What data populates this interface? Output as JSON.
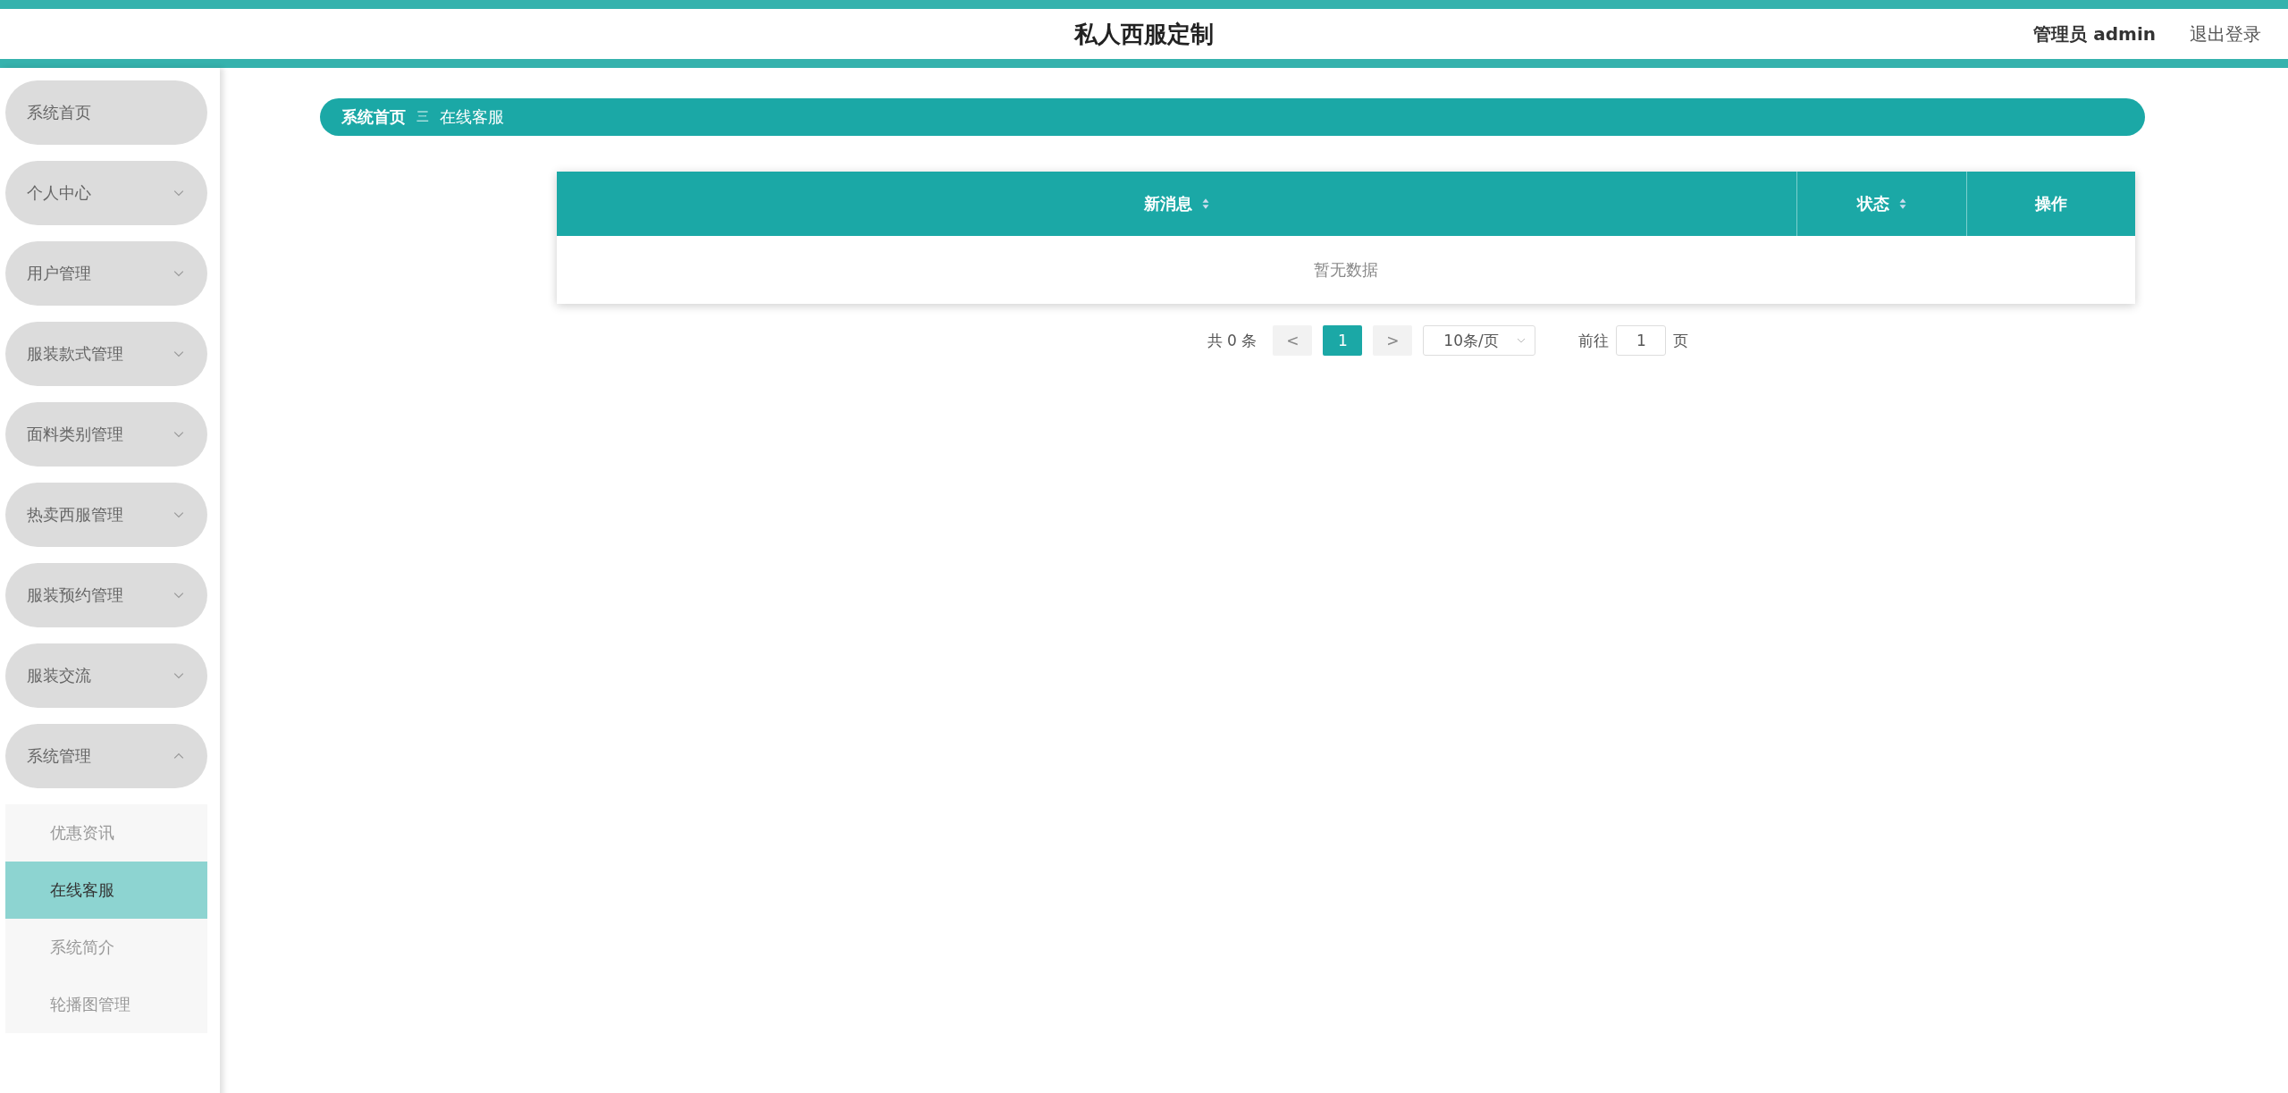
{
  "header": {
    "title": "私人西服定制",
    "user": "管理员 admin",
    "logout": "退出登录"
  },
  "sidebar": {
    "items": [
      {
        "label": "系统首页",
        "kind": "link"
      },
      {
        "label": "个人中心",
        "kind": "group",
        "expanded": false
      },
      {
        "label": "用户管理",
        "kind": "group",
        "expanded": false
      },
      {
        "label": "服装款式管理",
        "kind": "group",
        "expanded": false
      },
      {
        "label": "面料类别管理",
        "kind": "group",
        "expanded": false
      },
      {
        "label": "热卖西服管理",
        "kind": "group",
        "expanded": false
      },
      {
        "label": "服装预约管理",
        "kind": "group",
        "expanded": false
      },
      {
        "label": "服装交流",
        "kind": "group",
        "expanded": false
      },
      {
        "label": "系统管理",
        "kind": "group",
        "expanded": true,
        "children": [
          {
            "label": "优惠资讯",
            "selected": false
          },
          {
            "label": "在线客服",
            "selected": true
          },
          {
            "label": "系统简介",
            "selected": false
          },
          {
            "label": "轮播图管理",
            "selected": false
          }
        ]
      }
    ]
  },
  "breadcrumb": {
    "home": "系统首页",
    "separator": "三",
    "current": "在线客服"
  },
  "table": {
    "columns": [
      {
        "label": "新消息",
        "sortable": true
      },
      {
        "label": "状态",
        "sortable": true
      },
      {
        "label": "操作",
        "sortable": false
      }
    ],
    "empty_text": "暂无数据"
  },
  "pagination": {
    "total": "共 0 条",
    "prev": "<",
    "pages": [
      {
        "label": "1",
        "selected": true
      }
    ],
    "next": ">",
    "page_size": "10条/页",
    "goto_label": "前往",
    "goto_value": "1",
    "page_unit": "页"
  }
}
